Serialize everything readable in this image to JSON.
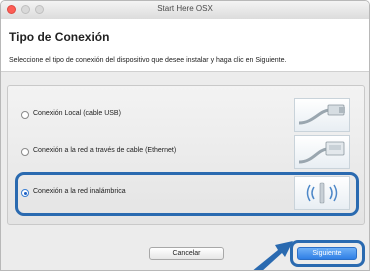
{
  "window": {
    "title": "Start Here OSX"
  },
  "header": {
    "title": "Tipo de Conexión",
    "instruction": "Seleccione el tipo de conexión del dispositivo que desee instalar y haga clic en Siguiente."
  },
  "options": [
    {
      "label": "Conexión Local (cable USB)",
      "selected": false,
      "icon": "usb-cable-icon"
    },
    {
      "label": "Conexión a la red a través de cable (Ethernet)",
      "selected": false,
      "icon": "ethernet-cable-icon"
    },
    {
      "label": "Conexión a la red inalámbrica",
      "selected": true,
      "icon": "wireless-icon"
    }
  ],
  "buttons": {
    "cancel": "Cancelar",
    "next": "Siguiente"
  },
  "colors": {
    "highlight": "#2a6ab0",
    "primary_button": "#2f7fe5"
  }
}
